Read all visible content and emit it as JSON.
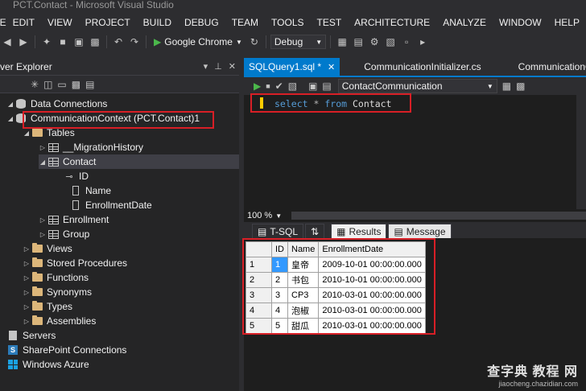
{
  "window": {
    "title": "PCT.Contact - Microsoft Visual Studio"
  },
  "menu": [
    "FILE",
    "EDIT",
    "VIEW",
    "PROJECT",
    "BUILD",
    "DEBUG",
    "TEAM",
    "TOOLS",
    "TEST",
    "ARCHITECTURE",
    "ANALYZE",
    "WINDOW",
    "HELP"
  ],
  "toolbar": {
    "run_target": "Google Chrome",
    "configuration": "Debug"
  },
  "explorer": {
    "title": "ver Explorer",
    "items": [
      {
        "label": "Data Connections"
      },
      {
        "label": "CommunicationContext (PCT.Contact)1"
      },
      {
        "label": "Tables"
      },
      {
        "label": "__MigrationHistory"
      },
      {
        "label": "Contact"
      },
      {
        "label": "ID"
      },
      {
        "label": "Name"
      },
      {
        "label": "EnrollmentDate"
      },
      {
        "label": "Enrollment"
      },
      {
        "label": "Group"
      },
      {
        "label": "Views"
      },
      {
        "label": "Stored Procedures"
      },
      {
        "label": "Functions"
      },
      {
        "label": "Synonyms"
      },
      {
        "label": "Types"
      },
      {
        "label": "Assemblies"
      },
      {
        "label": "Servers"
      },
      {
        "label": "SharePoint Connections"
      },
      {
        "label": "Windows Azure"
      }
    ]
  },
  "editor": {
    "tabs": [
      {
        "label": "SQLQuery1.sql *"
      },
      {
        "label": "CommunicationInitializer.cs"
      },
      {
        "label": "CommunicationC"
      }
    ],
    "database": "ContactCommunication",
    "query": {
      "kw1": "select",
      "star": "*",
      "kw2": "from",
      "table": "Contact"
    },
    "zoom": "100 %",
    "tsql_label": "T-SQL",
    "results_tab": "Results",
    "messages_tab": "Message"
  },
  "results": {
    "columns": [
      "ID",
      "Name",
      "EnrollmentDate"
    ],
    "rows": [
      [
        "1",
        "1",
        "皇帝",
        "2009-10-01 00:00:00.000"
      ],
      [
        "2",
        "2",
        "书包",
        "2010-10-01 00:00:00.000"
      ],
      [
        "3",
        "3",
        "CP3",
        "2010-03-01 00:00:00.000"
      ],
      [
        "4",
        "4",
        "泡椒",
        "2010-03-01 00:00:00.000"
      ],
      [
        "5",
        "5",
        "甜瓜",
        "2010-03-01 00:00:00.000"
      ]
    ]
  },
  "watermark": {
    "line1": "查字典 教程 网",
    "line2": "jiaocheng.chazidian.com"
  }
}
